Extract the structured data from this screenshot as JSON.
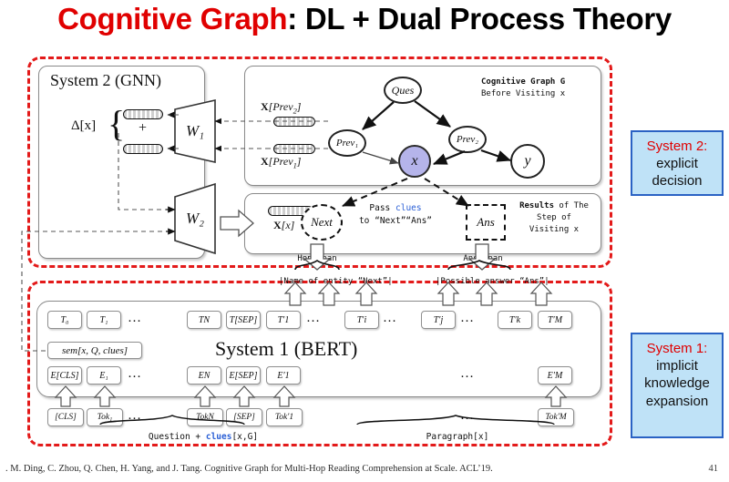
{
  "title": {
    "highlight": "Cognitive Graph",
    "rest": ": DL + Dual Process Theory"
  },
  "system2_panel": {
    "label": "System 2 (GNN)",
    "delta_label": "Δ[x]",
    "plus": "+",
    "w1": "W₁",
    "w2": "W₂"
  },
  "graph_panel": {
    "caption_bold": "Cognitive Graph G",
    "caption_sub": "Before Visiting x",
    "vec_prev2_label": "X[Prev₂]",
    "vec_prev1_label": "X[Prev₁]",
    "nodes": [
      {
        "id": "ques",
        "label": "Ques"
      },
      {
        "id": "prev2",
        "label": "Prev₂"
      },
      {
        "id": "prev1",
        "label": "Prev₁"
      },
      {
        "id": "x",
        "label": "x",
        "fill": "#b5b4ea"
      },
      {
        "id": "y",
        "label": "y"
      }
    ]
  },
  "results_panel": {
    "vec_x_label": "X[x]",
    "next_node": "Next",
    "ans_node": "Ans",
    "pass_line1_pre": "Pass ",
    "pass_line1_blue": "clues",
    "pass_line2": "to “Next”“Ans”",
    "caption_bold": "Results",
    "caption_rest": " of The",
    "caption_line2": "Step of",
    "caption_line3": "Visiting x",
    "hop_span": "Hop span",
    "ans_span": "Ans span"
  },
  "bridge_labels": {
    "name_of_entity": "|Name of entity “Next”|",
    "possible_answer": "|Possible answer “Ans”|"
  },
  "bert_panel": {
    "label": "System 1 (BERT)",
    "sem_box": "sem[x, Q, clues]",
    "t_row": [
      "T₀",
      "T₁",
      "…",
      "TN",
      "T[SEP]",
      "T′1",
      "…",
      "T′i",
      "…",
      "T′j",
      "…",
      "T′k",
      "T′M"
    ],
    "e_row": [
      "E[CLS]",
      "E₁",
      "…",
      "EN",
      "E[SEP]",
      "E′1",
      "…",
      "E′M"
    ],
    "tok_row": [
      "[CLS]",
      "Tok₁",
      "…",
      "TokN",
      "[SEP]",
      "Tok′1",
      "…",
      "Tok′M"
    ],
    "question_pre": "Question + ",
    "question_blue": "clues",
    "question_post": "[x,G]",
    "paragraph": "Paragraph[x]"
  },
  "callouts": {
    "system2": {
      "head": "System 2:",
      "body_line1": "explicit",
      "body_line2": "decision",
      "bg": "#bfe2f7",
      "border": "#2a62c4",
      "head_color": "#e00000"
    },
    "system1": {
      "head": "System 1:",
      "body_line1": "implicit",
      "body_line2": "knowledge",
      "body_line3": "expansion",
      "bg": "#bfe2f7",
      "border": "#2a62c4",
      "head_color": "#e00000"
    }
  },
  "footer": {
    "citation": ".  M. Ding, C. Zhou, Q. Chen, H. Yang, and J. Tang. Cognitive Graph for Multi-Hop Reading Comprehension at Scale. ACL’19.",
    "page": "41"
  },
  "colors": {
    "title_accent": "#e00000",
    "dashed_region": "#e31a1a",
    "clue_blue": "#2a5fd6",
    "node_x_fill": "#b5b4ea"
  }
}
